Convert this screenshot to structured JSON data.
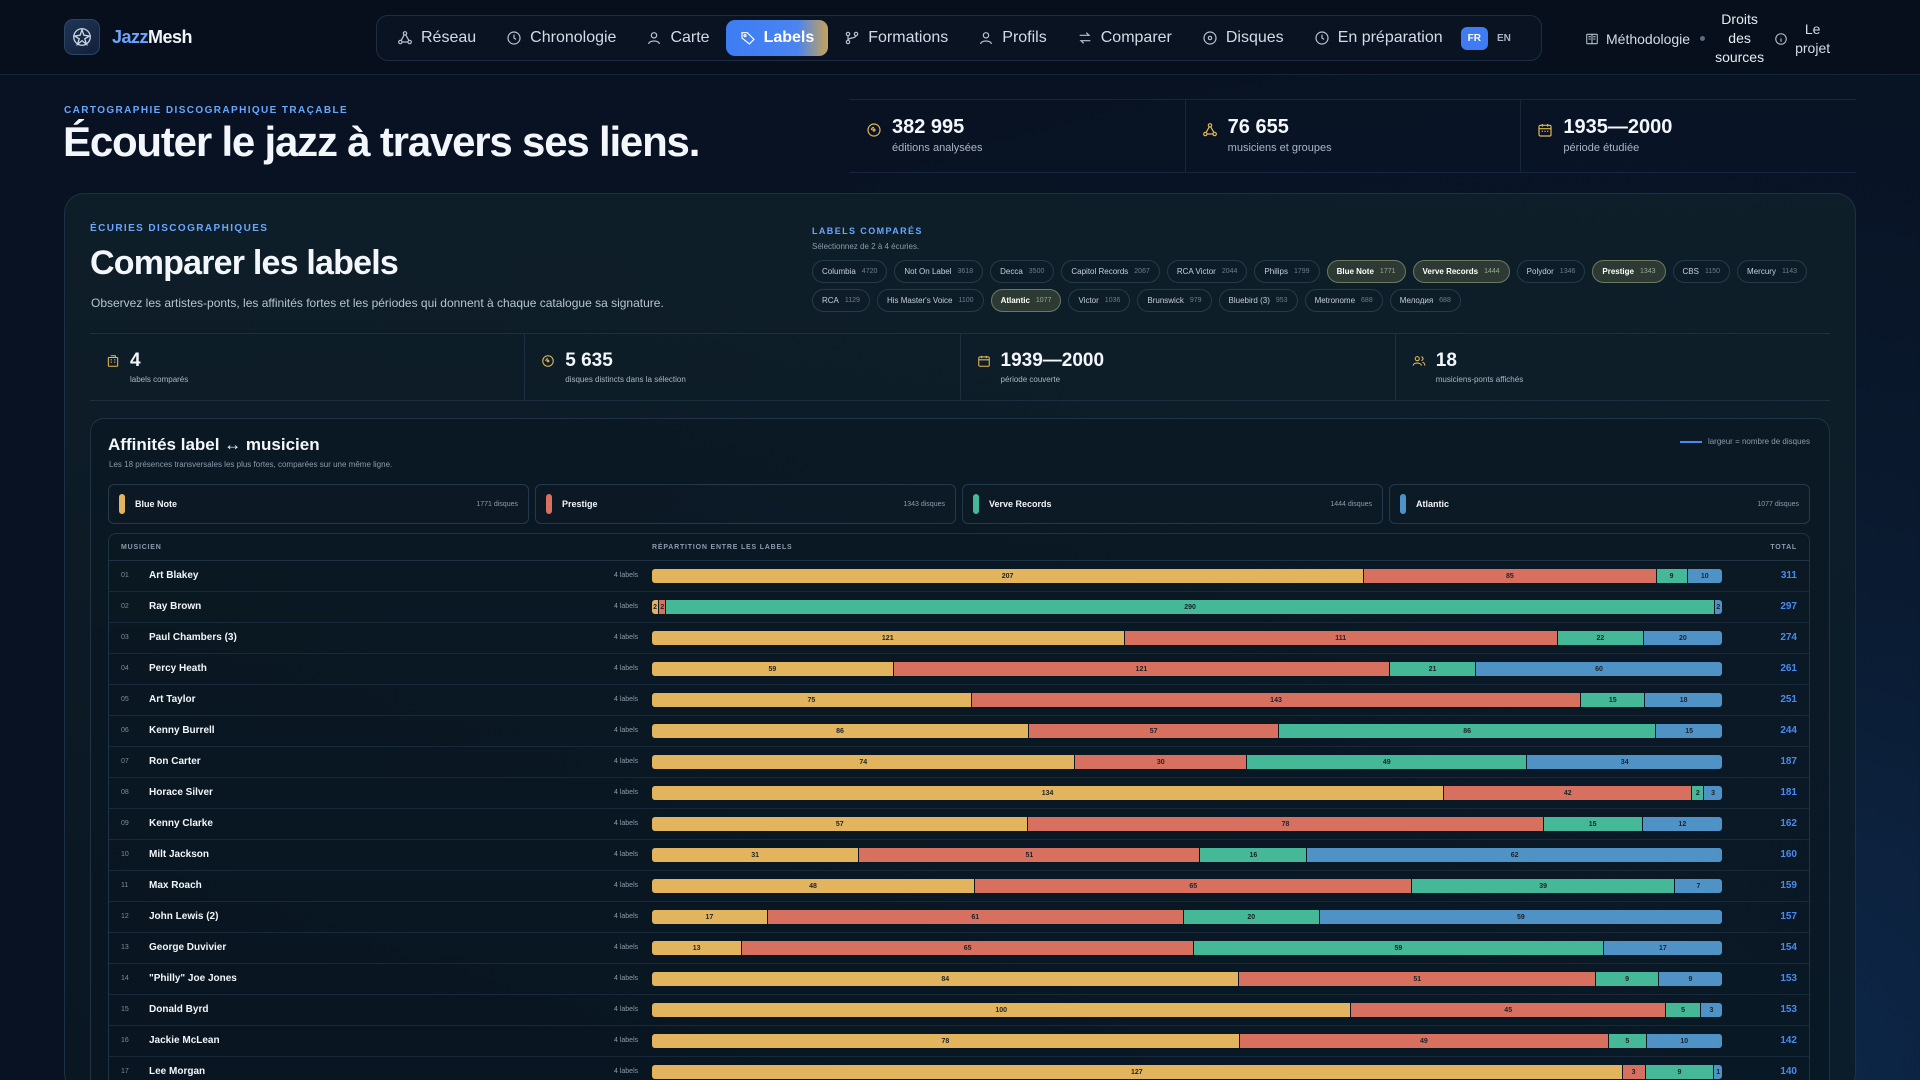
{
  "app": {
    "name_a": "Jazz",
    "name_b": "Mesh"
  },
  "nav": {
    "items": [
      {
        "label": "Réseau",
        "icon": "network-icon",
        "active": false
      },
      {
        "label": "Chronologie",
        "icon": "clock-icon",
        "active": false
      },
      {
        "label": "Carte",
        "icon": "map-pin-icon",
        "active": false
      },
      {
        "label": "Labels",
        "icon": "tag-icon",
        "active": true
      },
      {
        "label": "Formations",
        "icon": "branch-icon",
        "active": false
      },
      {
        "label": "Profils",
        "icon": "user-icon",
        "active": false
      },
      {
        "label": "Comparer",
        "icon": "swap-icon",
        "active": false
      },
      {
        "label": "Disques",
        "icon": "disc-icon",
        "active": false
      },
      {
        "label": "En préparation",
        "icon": "clock-icon",
        "active": false
      }
    ],
    "lang_fr": "FR",
    "lang_en": "EN",
    "methodologie": "Méthodologie",
    "droits": [
      "Droits",
      "des",
      "sources"
    ],
    "projet": [
      "Le",
      "projet"
    ]
  },
  "hero": {
    "eyebrow": "CARTOGRAPHIE DISCOGRAPHIQUE TRAÇABLE",
    "title": "Écouter le jazz à travers ses liens.",
    "stats": [
      {
        "value": "382 995",
        "label": "éditions analysées",
        "icon": "disc-icon"
      },
      {
        "value": "76 655",
        "label": "musiciens et groupes",
        "icon": "network-icon"
      },
      {
        "value": "1935—2000",
        "label": "période étudiée",
        "icon": "calendar-icon"
      }
    ]
  },
  "section": {
    "eyebrow": "ÉCURIES DISCOGRAPHIQUES",
    "title": "Comparer les labels",
    "description": "Observez les artistes-ponts, les affinités fortes et les périodes qui donnent à chaque catalogue sa signature."
  },
  "labels_box": {
    "eyebrow": "LABELS COMPARÉS",
    "sub": "Sélectionnez de 2 à 4 écuries.",
    "chips": [
      {
        "name": "Columbia",
        "count": "4720",
        "selected": false
      },
      {
        "name": "Not On Label",
        "count": "3618",
        "selected": false
      },
      {
        "name": "Decca",
        "count": "3500",
        "selected": false
      },
      {
        "name": "Capitol Records",
        "count": "2067",
        "selected": false
      },
      {
        "name": "RCA Victor",
        "count": "2044",
        "selected": false
      },
      {
        "name": "Philips",
        "count": "1799",
        "selected": false
      },
      {
        "name": "Blue Note",
        "count": "1771",
        "selected": true
      },
      {
        "name": "Verve Records",
        "count": "1444",
        "selected": true
      },
      {
        "name": "Polydor",
        "count": "1346",
        "selected": false
      },
      {
        "name": "Prestige",
        "count": "1343",
        "selected": true
      },
      {
        "name": "CBS",
        "count": "1150",
        "selected": false
      },
      {
        "name": "Mercury",
        "count": "1143",
        "selected": false
      },
      {
        "name": "RCA",
        "count": "1129",
        "selected": false
      },
      {
        "name": "His Master's Voice",
        "count": "1100",
        "selected": false
      },
      {
        "name": "Atlantic",
        "count": "1077",
        "selected": true
      },
      {
        "name": "Victor",
        "count": "1036",
        "selected": false
      },
      {
        "name": "Brunswick",
        "count": "979",
        "selected": false
      },
      {
        "name": "Bluebird (3)",
        "count": "953",
        "selected": false
      },
      {
        "name": "Metronome",
        "count": "688",
        "selected": false
      },
      {
        "name": "Мелодия",
        "count": "688",
        "selected": false
      }
    ]
  },
  "selection_stats": [
    {
      "value": "4",
      "label": "labels comparés",
      "icon": "building-icon"
    },
    {
      "value": "5 635",
      "label": "disques distincts dans la sélection",
      "icon": "disc-icon"
    },
    {
      "value": "1939—2000",
      "label": "période couverte",
      "icon": "calendar-icon"
    },
    {
      "value": "18",
      "label": "musiciens-ponts affichés",
      "icon": "users-icon"
    }
  ],
  "affinities": {
    "title": "Affinités label ↔ musicien",
    "subtitle": "Les 18 présences transversales les plus fortes, comparées sur une même ligne.",
    "legend": "largeur = nombre de disques",
    "labels": [
      {
        "name": "Blue Note",
        "count": "1771 disques",
        "color": "#e3b45e"
      },
      {
        "name": "Prestige",
        "count": "1343 disques",
        "color": "#d8705f"
      },
      {
        "name": "Verve Records",
        "count": "1444 disques",
        "color": "#45b898"
      },
      {
        "name": "Atlantic",
        "count": "1077 disques",
        "color": "#4f93c6"
      }
    ],
    "headers": {
      "musician": "MUSICIEN",
      "split": "RÉPARTITION ENTRE LES LABELS",
      "total": "TOTAL"
    },
    "rows": [
      {
        "idx": "01",
        "name": "Art Blakey",
        "count": "4 labels",
        "values": [
          207,
          85,
          9,
          10
        ],
        "total": "311"
      },
      {
        "idx": "02",
        "name": "Ray Brown",
        "count": "4 labels",
        "values": [
          2,
          2,
          290,
          2
        ],
        "total": "297"
      },
      {
        "idx": "03",
        "name": "Paul Chambers (3)",
        "count": "4 labels",
        "values": [
          121,
          111,
          22,
          20
        ],
        "total": "274"
      },
      {
        "idx": "04",
        "name": "Percy Heath",
        "count": "4 labels",
        "values": [
          59,
          121,
          21,
          60
        ],
        "total": "261"
      },
      {
        "idx": "05",
        "name": "Art Taylor",
        "count": "4 labels",
        "values": [
          75,
          143,
          15,
          18
        ],
        "total": "251"
      },
      {
        "idx": "06",
        "name": "Kenny Burrell",
        "count": "4 labels",
        "values": [
          86,
          57,
          86,
          15
        ],
        "total": "244"
      },
      {
        "idx": "07",
        "name": "Ron Carter",
        "count": "4 labels",
        "values": [
          74,
          30,
          49,
          34
        ],
        "total": "187"
      },
      {
        "idx": "08",
        "name": "Horace Silver",
        "count": "4 labels",
        "values": [
          134,
          42,
          2,
          3
        ],
        "total": "181"
      },
      {
        "idx": "09",
        "name": "Kenny Clarke",
        "count": "4 labels",
        "values": [
          57,
          78,
          15,
          12
        ],
        "total": "162"
      },
      {
        "idx": "10",
        "name": "Milt Jackson",
        "count": "4 labels",
        "values": [
          31,
          51,
          16,
          62
        ],
        "total": "160"
      },
      {
        "idx": "11",
        "name": "Max Roach",
        "count": "4 labels",
        "values": [
          48,
          65,
          39,
          7
        ],
        "total": "159"
      },
      {
        "idx": "12",
        "name": "John Lewis (2)",
        "count": "4 labels",
        "values": [
          17,
          61,
          20,
          59
        ],
        "total": "157"
      },
      {
        "idx": "13",
        "name": "George Duvivier",
        "count": "4 labels",
        "values": [
          13,
          65,
          59,
          17
        ],
        "total": "154"
      },
      {
        "idx": "14",
        "name": "\"Philly\" Joe Jones",
        "count": "4 labels",
        "values": [
          84,
          51,
          9,
          9
        ],
        "total": "153"
      },
      {
        "idx": "15",
        "name": "Donald Byrd",
        "count": "4 labels",
        "values": [
          100,
          45,
          5,
          3
        ],
        "total": "153"
      },
      {
        "idx": "16",
        "name": "Jackie McLean",
        "count": "4 labels",
        "values": [
          78,
          49,
          5,
          10
        ],
        "total": "142"
      },
      {
        "idx": "17",
        "name": "Lee Morgan",
        "count": "4 labels",
        "values": [
          127,
          3,
          9,
          1
        ],
        "total": "140"
      }
    ]
  }
}
